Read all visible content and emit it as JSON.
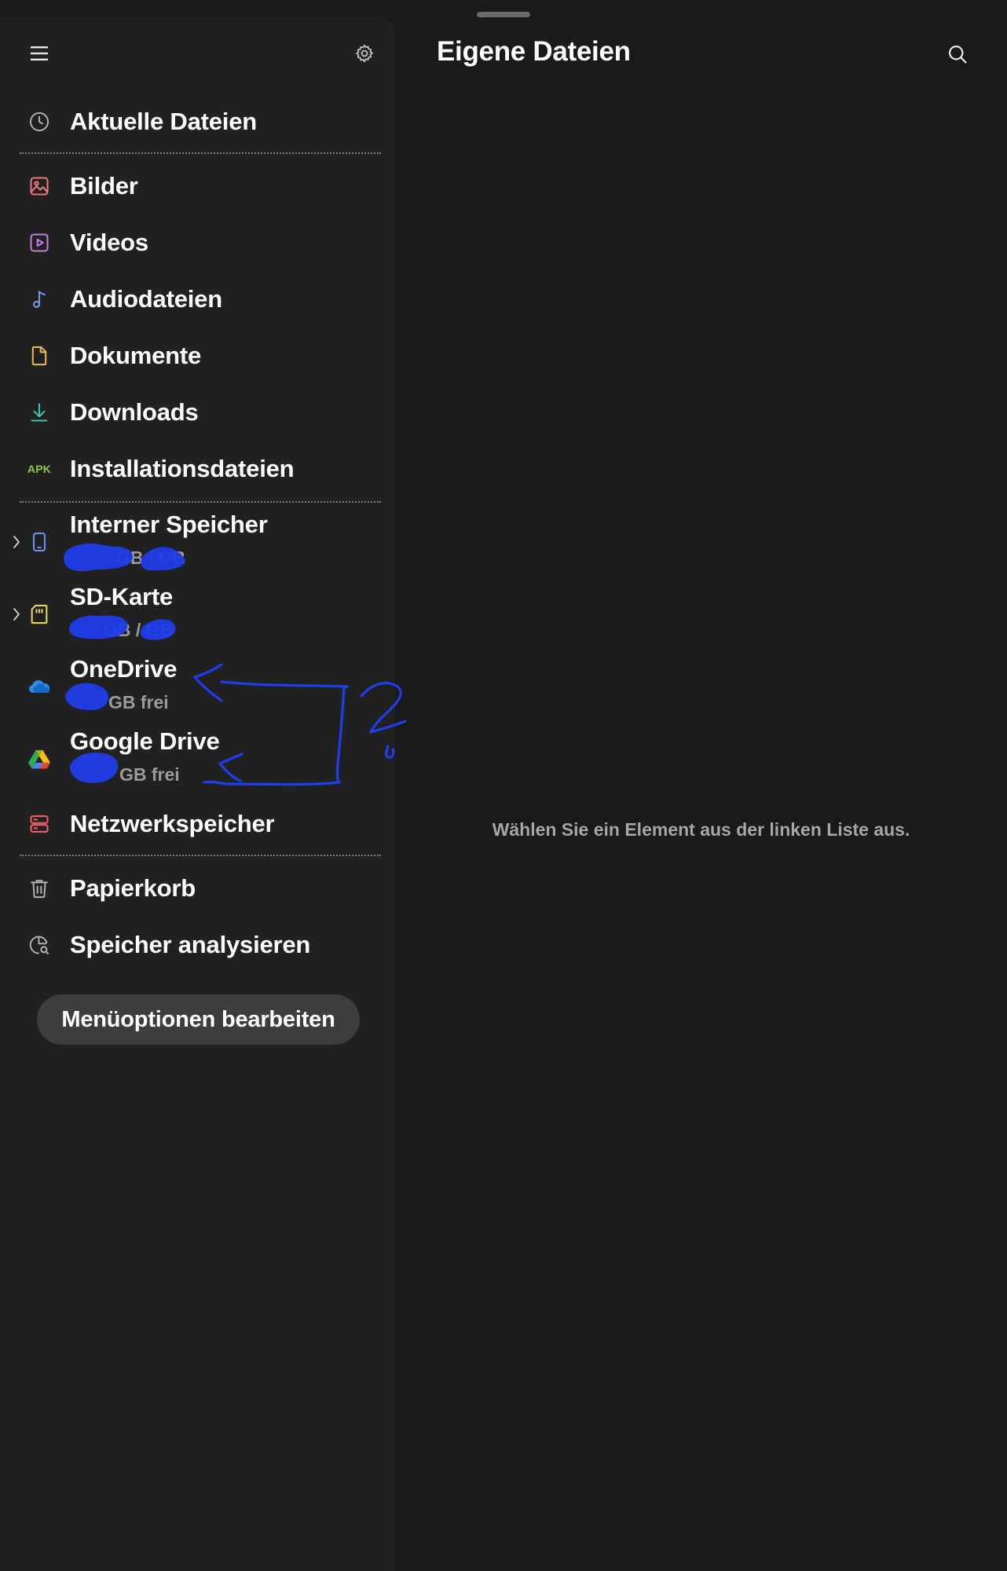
{
  "header": {
    "title": "Eigene Dateien"
  },
  "drawer": {
    "recent": {
      "label": "Aktuelle Dateien",
      "icon": "clock-icon"
    },
    "categories": [
      {
        "label": "Bilder",
        "icon": "image-icon",
        "color": "#e8787a"
      },
      {
        "label": "Videos",
        "icon": "video-icon",
        "color": "#c27be0"
      },
      {
        "label": "Audiodateien",
        "icon": "music-note-icon",
        "color": "#6a9be8"
      },
      {
        "label": "Dokumente",
        "icon": "document-icon",
        "color": "#e6b35a"
      },
      {
        "label": "Downloads",
        "icon": "download-icon",
        "color": "#3ec2b0"
      },
      {
        "label": "Installationsdateien",
        "icon": "apk-icon",
        "icon_text": "APK",
        "color": "#8cc63f"
      }
    ],
    "storage": [
      {
        "title": "Interner Speicher",
        "subtitle": "GB / GB",
        "icon": "phone-icon",
        "color": "#6a8fe8"
      },
      {
        "title": "SD-Karte",
        "subtitle": "GB / GB",
        "icon": "sd-card-icon",
        "color": "#e6d35a"
      },
      {
        "title": "OneDrive",
        "subtitle": "GB frei",
        "icon": "onedrive-icon",
        "color": "#2f8de4"
      },
      {
        "title": "Google Drive",
        "subtitle": "GB frei",
        "icon": "google-drive-icon",
        "color": "#34a853"
      },
      {
        "title": "Netzwerkspeicher",
        "icon": "server-icon",
        "color": "#e8606a"
      }
    ],
    "tools": [
      {
        "label": "Papierkorb",
        "icon": "trash-icon"
      },
      {
        "label": "Speicher analysieren",
        "icon": "storage-analysis-icon"
      }
    ],
    "edit_button": "Menüoptionen bearbeiten"
  },
  "content": {
    "empty_hint": "Wählen Sie ein Element aus der linken Liste aus."
  }
}
